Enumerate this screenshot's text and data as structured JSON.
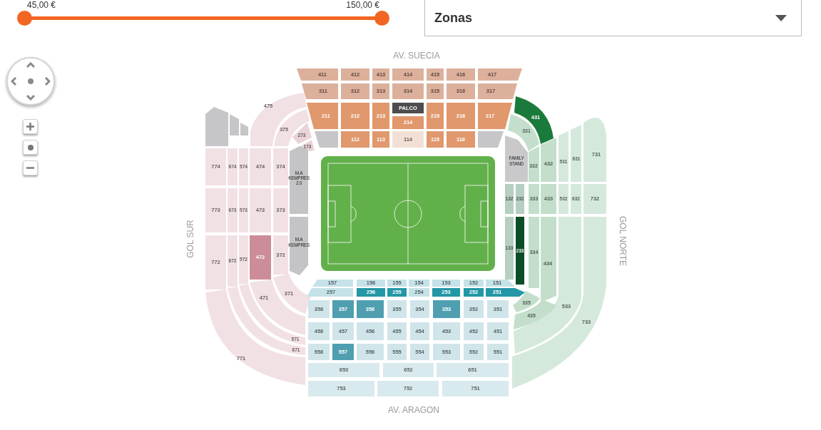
{
  "price_filter": {
    "thumbs": [
      {
        "reading": "45,00 €"
      },
      {
        "reading": "150,00 €"
      }
    ]
  },
  "zone_select": {
    "value": "Zonas"
  },
  "stadium": {
    "top_label": "AV. SUECIA",
    "left_label": "GOL SUR",
    "right_label": "GOL NORTE",
    "bottom_label": "AV. ARAGON",
    "sections": [
      {
        "label": "411",
        "color": "#ddb09b",
        "kind": "seat"
      },
      {
        "label": "412",
        "color": "#ddb09b",
        "kind": "seat"
      },
      {
        "label": "413",
        "color": "#ddb09b",
        "kind": "seat"
      },
      {
        "label": "414",
        "color": "#ddb09b",
        "kind": "seat"
      },
      {
        "label": "415",
        "color": "#ddb09b",
        "kind": "seat"
      },
      {
        "label": "416",
        "color": "#ddb09b",
        "kind": "seat"
      },
      {
        "label": "417",
        "color": "#ddb09b",
        "kind": "seat"
      },
      {
        "label": "311",
        "color": "#ddb09b",
        "kind": "seat"
      },
      {
        "label": "312",
        "color": "#ddb09b",
        "kind": "seat"
      },
      {
        "label": "313",
        "color": "#ddb09b",
        "kind": "seat"
      },
      {
        "label": "314",
        "color": "#ddb09b",
        "kind": "seat"
      },
      {
        "label": "315",
        "color": "#ddb09b",
        "kind": "seat"
      },
      {
        "label": "316",
        "color": "#ddb09b",
        "kind": "seat"
      },
      {
        "label": "317",
        "color": "#ddb09b",
        "kind": "seat"
      },
      {
        "label": "211",
        "color": "#e0986c",
        "kind": "seat"
      },
      {
        "label": "212",
        "color": "#e0986c",
        "kind": "seat"
      },
      {
        "label": "213",
        "color": "#e0986c",
        "kind": "seat"
      },
      {
        "label": "PALCO",
        "color": "#4d4d4f",
        "kind": "seat"
      },
      {
        "label": "214",
        "color": "#e0986c",
        "kind": "seat"
      },
      {
        "label": "215",
        "color": "#e0986c",
        "kind": "seat"
      },
      {
        "label": "216",
        "color": "#e0986c",
        "kind": "seat"
      },
      {
        "label": "217",
        "color": "#e0986c",
        "kind": "seat"
      },
      {
        "label": "112",
        "color": "#e0986c",
        "kind": "seat"
      },
      {
        "label": "113",
        "color": "#e0986c",
        "kind": "seat"
      },
      {
        "label": "114",
        "color": "#f3e0d5",
        "kind": "seat"
      },
      {
        "label": "115",
        "color": "#e0986c",
        "kind": "seat"
      },
      {
        "label": "116",
        "color": "#e0986c",
        "kind": "seat"
      },
      {
        "label": "475",
        "color": "#f2e1e4",
        "kind": "seat"
      },
      {
        "label": "375",
        "color": "#f2e1e4",
        "kind": "seat"
      },
      {
        "label": "273",
        "color": "#ead3d7",
        "kind": "seat"
      },
      {
        "label": "173",
        "color": "#ead3d7",
        "kind": "seat"
      },
      {
        "label": "774",
        "color": "#f2e1e4",
        "kind": "seat"
      },
      {
        "label": "674",
        "color": "#f2e1e4",
        "kind": "seat"
      },
      {
        "label": "574",
        "color": "#f2e1e4",
        "kind": "seat"
      },
      {
        "label": "474",
        "color": "#f2e1e4",
        "kind": "seat"
      },
      {
        "label": "374",
        "color": "#f2e1e4",
        "kind": "seat"
      },
      {
        "label": "M.A KEMPRES 2.0",
        "color": "#c4c4c6",
        "kind": "area"
      },
      {
        "label": "773",
        "color": "#f2e1e4",
        "kind": "seat"
      },
      {
        "label": "673",
        "color": "#f2e1e4",
        "kind": "seat"
      },
      {
        "label": "573",
        "color": "#f2e1e4",
        "kind": "seat"
      },
      {
        "label": "473",
        "color": "#f2e1e4",
        "kind": "seat"
      },
      {
        "label": "373",
        "color": "#f2e1e4",
        "kind": "seat"
      },
      {
        "label": "M.A KEMPRES",
        "color": "#c4c4c6",
        "kind": "area"
      },
      {
        "label": "772",
        "color": "#f2e1e4",
        "kind": "seat"
      },
      {
        "label": "672",
        "color": "#f2e1e4",
        "kind": "seat"
      },
      {
        "label": "572",
        "color": "#f2e1e4",
        "kind": "seat"
      },
      {
        "label": "472",
        "color": "#cc8d98",
        "kind": "seat"
      },
      {
        "label": "372",
        "color": "#f2e1e4",
        "kind": "seat"
      },
      {
        "label": "371",
        "color": "#f2e1e4",
        "kind": "seat"
      },
      {
        "label": "471",
        "color": "#f2e1e4",
        "kind": "seat"
      },
      {
        "label": "571",
        "color": "#f2e1e4",
        "kind": "seat"
      },
      {
        "label": "671",
        "color": "#f2e1e4",
        "kind": "seat"
      },
      {
        "label": "771",
        "color": "#f2e1e4",
        "kind": "seat"
      },
      {
        "label": "431",
        "color": "#1a7a3b",
        "kind": "seat"
      },
      {
        "label": "331",
        "color": "#c3dfcc",
        "kind": "seat"
      },
      {
        "label": "FAMILY STAND",
        "color": "#c9c9cb",
        "kind": "area"
      },
      {
        "label": "332",
        "color": "#c3dfcc",
        "kind": "seat"
      },
      {
        "label": "432",
        "color": "#c3dfcc",
        "kind": "seat"
      },
      {
        "label": "531",
        "color": "#d4e9dc",
        "kind": "seat"
      },
      {
        "label": "631",
        "color": "#d4e9dc",
        "kind": "seat"
      },
      {
        "label": "731",
        "color": "#d4e9dc",
        "kind": "seat"
      },
      {
        "label": "132",
        "color": "#b5cfc0",
        "kind": "seat"
      },
      {
        "label": "232",
        "color": "#b5cfc0",
        "kind": "seat"
      },
      {
        "label": "333",
        "color": "#c3dfcc",
        "kind": "seat"
      },
      {
        "label": "433",
        "color": "#c3dfcc",
        "kind": "seat"
      },
      {
        "label": "532",
        "color": "#d4e9dc",
        "kind": "seat"
      },
      {
        "label": "632",
        "color": "#d4e9dc",
        "kind": "seat"
      },
      {
        "label": "732",
        "color": "#d4e9dc",
        "kind": "seat"
      },
      {
        "label": "133",
        "color": "#b5cfc0",
        "kind": "seat"
      },
      {
        "label": "233",
        "color": "#0b4d27",
        "kind": "seat"
      },
      {
        "label": "334",
        "color": "#c3dfcc",
        "kind": "seat"
      },
      {
        "label": "434",
        "color": "#c3dfcc",
        "kind": "seat"
      },
      {
        "label": "533",
        "color": "#d4e9dc",
        "kind": "seat"
      },
      {
        "label": "733",
        "color": "#d4e9dc",
        "kind": "seat"
      },
      {
        "label": "335",
        "color": "#c3dfcc",
        "kind": "seat"
      },
      {
        "label": "435",
        "color": "#c3dfcc",
        "kind": "seat"
      },
      {
        "label": "157",
        "color": "#c5e2e8",
        "kind": "seat"
      },
      {
        "label": "156",
        "color": "#c5e2e8",
        "kind": "seat"
      },
      {
        "label": "155",
        "color": "#c5e2e8",
        "kind": "seat"
      },
      {
        "label": "154",
        "color": "#c5e2e8",
        "kind": "seat"
      },
      {
        "label": "153",
        "color": "#c5e2e8",
        "kind": "seat"
      },
      {
        "label": "152",
        "color": "#c5e2e8",
        "kind": "seat"
      },
      {
        "label": "151",
        "color": "#c5e2e8",
        "kind": "seat"
      },
      {
        "label": "257",
        "color": "#c5e2e8",
        "kind": "seat"
      },
      {
        "label": "256",
        "color": "#2397a6",
        "kind": "seat"
      },
      {
        "label": "255",
        "color": "#2397a6",
        "kind": "seat"
      },
      {
        "label": "254",
        "color": "#c5e2e8",
        "kind": "seat"
      },
      {
        "label": "253",
        "color": "#2397a6",
        "kind": "seat"
      },
      {
        "label": "252",
        "color": "#2397a6",
        "kind": "seat"
      },
      {
        "label": "251",
        "color": "#2397a6",
        "kind": "seat"
      },
      {
        "label": "358",
        "color": "#d0e5ea",
        "kind": "seat"
      },
      {
        "label": "357",
        "color": "#4f9fb1",
        "kind": "seat"
      },
      {
        "label": "356",
        "color": "#4f9fb1",
        "kind": "seat"
      },
      {
        "label": "355",
        "color": "#d0e5ea",
        "kind": "seat"
      },
      {
        "label": "354",
        "color": "#d0e5ea",
        "kind": "seat"
      },
      {
        "label": "353",
        "color": "#4f9fb1",
        "kind": "seat"
      },
      {
        "label": "352",
        "color": "#d0e5ea",
        "kind": "seat"
      },
      {
        "label": "351",
        "color": "#d0e5ea",
        "kind": "seat"
      },
      {
        "label": "458",
        "color": "#d0e5ea",
        "kind": "seat"
      },
      {
        "label": "457",
        "color": "#d0e5ea",
        "kind": "seat"
      },
      {
        "label": "456",
        "color": "#d0e5ea",
        "kind": "seat"
      },
      {
        "label": "455",
        "color": "#d0e5ea",
        "kind": "seat"
      },
      {
        "label": "454",
        "color": "#d0e5ea",
        "kind": "seat"
      },
      {
        "label": "453",
        "color": "#d0e5ea",
        "kind": "seat"
      },
      {
        "label": "452",
        "color": "#d0e5ea",
        "kind": "seat"
      },
      {
        "label": "451",
        "color": "#d0e5ea",
        "kind": "seat"
      },
      {
        "label": "558",
        "color": "#d0e5ea",
        "kind": "seat"
      },
      {
        "label": "557",
        "color": "#4f9fb1",
        "kind": "seat"
      },
      {
        "label": "556",
        "color": "#d0e5ea",
        "kind": "seat"
      },
      {
        "label": "555",
        "color": "#d0e5ea",
        "kind": "seat"
      },
      {
        "label": "554",
        "color": "#d0e5ea",
        "kind": "seat"
      },
      {
        "label": "553",
        "color": "#d0e5ea",
        "kind": "seat"
      },
      {
        "label": "552",
        "color": "#d0e5ea",
        "kind": "seat"
      },
      {
        "label": "551",
        "color": "#d0e5ea",
        "kind": "seat"
      },
      {
        "label": "653",
        "color": "#d9eaee",
        "kind": "seat"
      },
      {
        "label": "652",
        "color": "#d9eaee",
        "kind": "seat"
      },
      {
        "label": "651",
        "color": "#d9eaee",
        "kind": "seat"
      },
      {
        "label": "753",
        "color": "#d9eaee",
        "kind": "seat"
      },
      {
        "label": "752",
        "color": "#d9eaee",
        "kind": "seat"
      },
      {
        "label": "751",
        "color": "#d9eaee",
        "kind": "seat"
      }
    ]
  }
}
